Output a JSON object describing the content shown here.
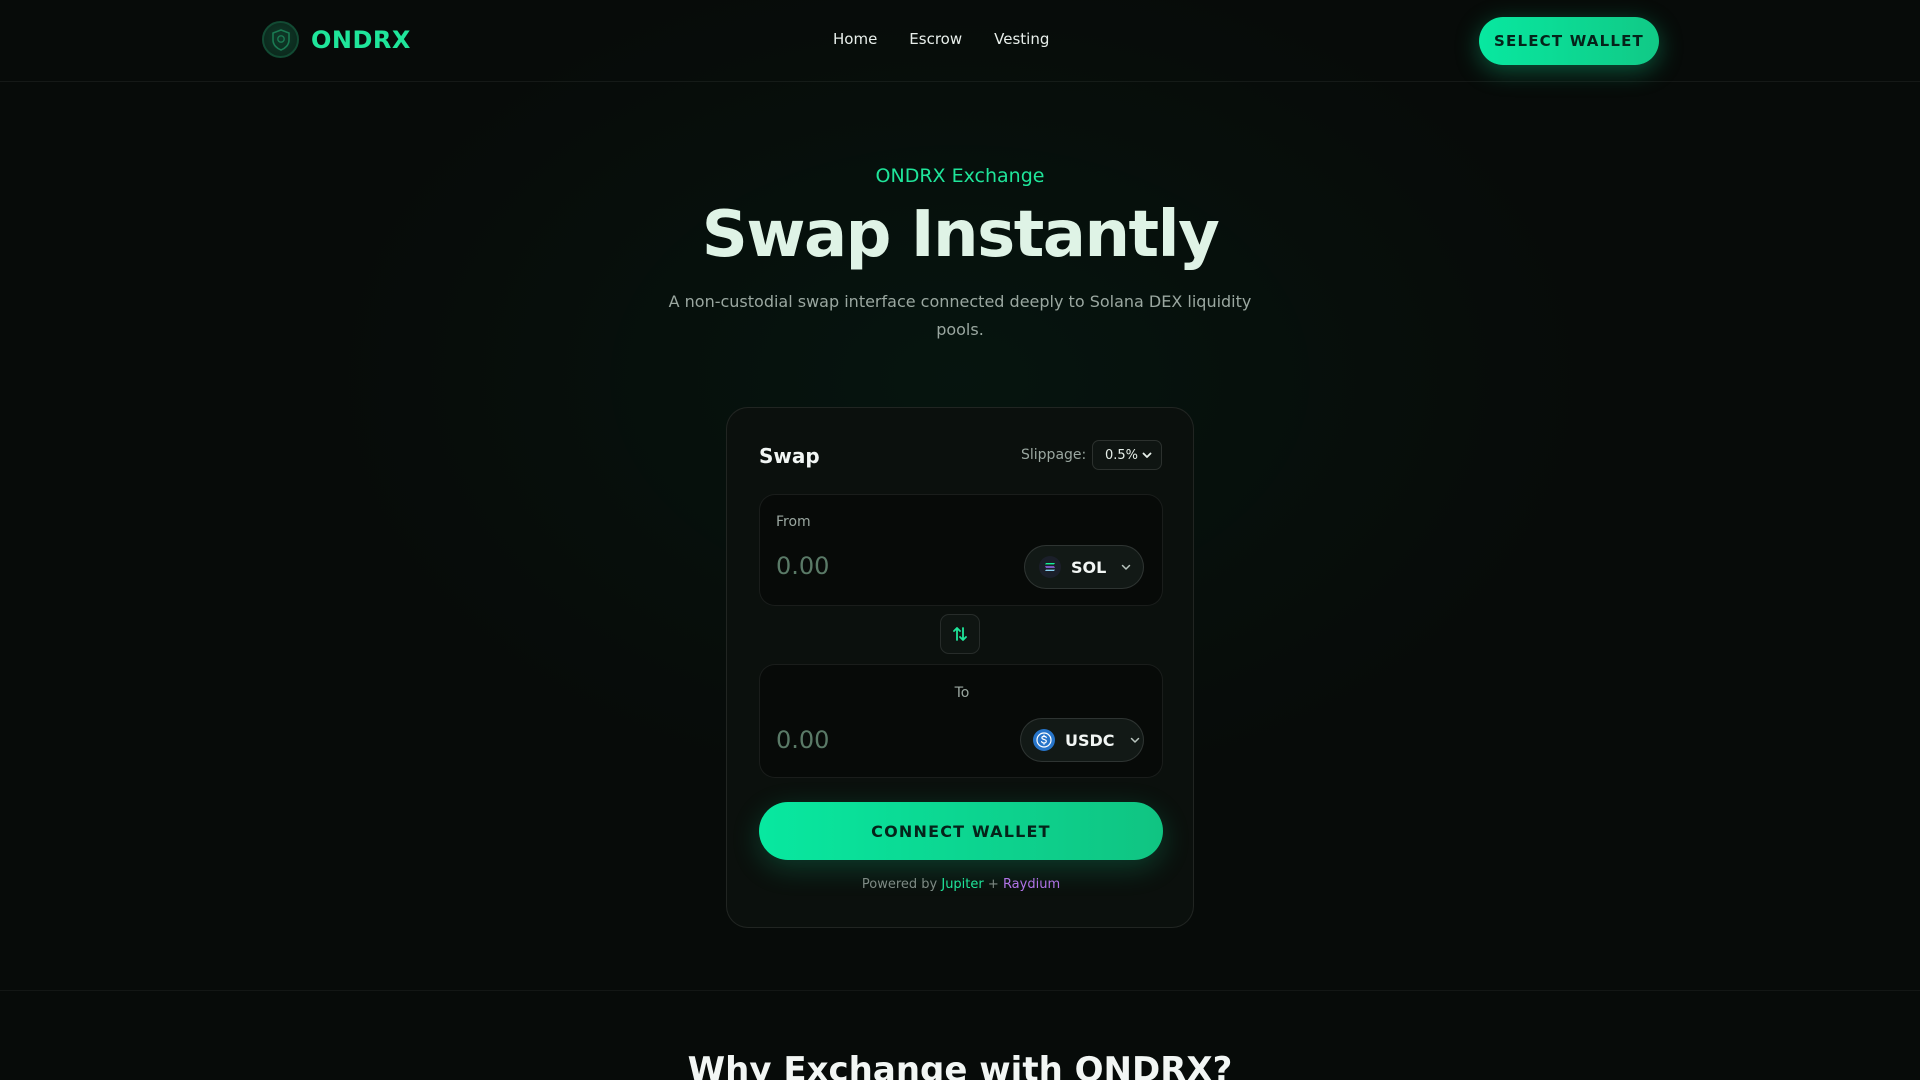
{
  "header": {
    "brand": "ONDRX",
    "nav": [
      {
        "label": "Home"
      },
      {
        "label": "Escrow"
      },
      {
        "label": "Vesting"
      }
    ],
    "select_wallet_label": "SELECT WALLET"
  },
  "hero": {
    "eyebrow": "ONDRX Exchange",
    "title": "Swap Instantly",
    "subtitle": "A non-custodial swap interface connected deeply to Solana DEX liquidity pools."
  },
  "swap": {
    "title": "Swap",
    "slippage_label": "Slippage:",
    "slippage_value": "0.5%",
    "from": {
      "label": "From",
      "placeholder": "0.00",
      "token": "SOL"
    },
    "to": {
      "label": "To",
      "placeholder": "0.00",
      "token": "USDC"
    },
    "connect_label": "CONNECT WALLET",
    "powered_prefix": "Powered by",
    "powered_jupiter": "Jupiter",
    "powered_plus": "+",
    "powered_raydium": "Raydium"
  },
  "section": {
    "title": "Why Exchange with ONDRX?"
  },
  "colors": {
    "accent": "#1fe59a",
    "background": "#070b09",
    "raydium": "#b073e6"
  },
  "icons": [
    "ondrx-logo-icon",
    "chevron-down-icon",
    "solana-icon",
    "usdc-icon",
    "swap-arrows-icon"
  ]
}
